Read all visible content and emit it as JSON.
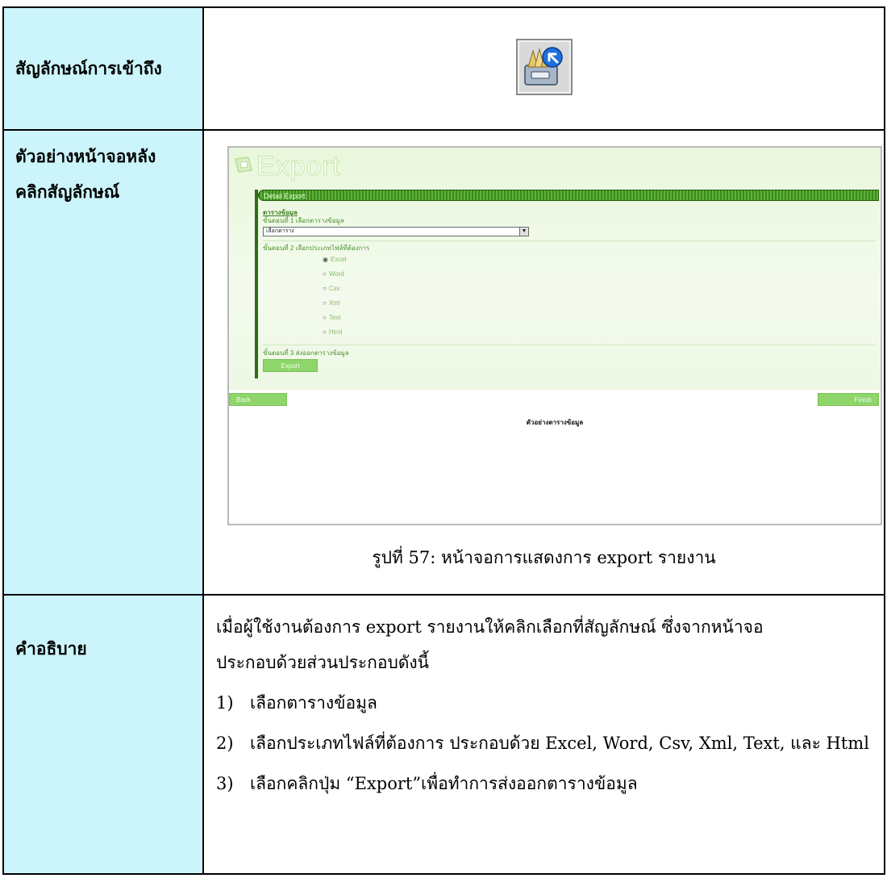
{
  "rows": {
    "icon_label": "สัญลักษณ์การเข้าถึง",
    "screenshot_label_line1": "ตัวอย่างหน้าจอหลัง",
    "screenshot_label_line2": "คลิกสัญลักษณ์",
    "description_label": "คำอธิบาย"
  },
  "icon": {
    "name": "export-drawer-icon",
    "accent": "#1d6fe0"
  },
  "screenshot": {
    "title": "Export",
    "panel_header": "Detail Export",
    "data_table_link": "ตารางข้อมูล",
    "step1_label": "ขั้นตอนที่ 1",
    "step1_text": "เลือกตารางข้อมูล",
    "table_select_value": "เลือกตาราง",
    "step2_label": "ขั้นตอนที่ 2",
    "step2_text": "เลือกประเภทไฟล์ที่ต้องการ",
    "file_types": [
      {
        "label": "Excel",
        "selected": true
      },
      {
        "label": "Word",
        "selected": false
      },
      {
        "label": "Csv",
        "selected": false
      },
      {
        "label": "Xml",
        "selected": false
      },
      {
        "label": "Text",
        "selected": false
      },
      {
        "label": "Html",
        "selected": false
      }
    ],
    "step3_label": "ขั้นตอนที่ 3",
    "step3_text": "ส่งออกตารางข้อมูล",
    "export_button": "Export",
    "back_button": "Back",
    "finish_button": "Finish",
    "preview_label": "ตัวอย่างตารางข้อมูล",
    "colors": {
      "accent": "#3b8a1e",
      "button": "#8ed56a",
      "background": "#eef8e4"
    }
  },
  "caption": "รูปที่ 57: หน้าจอการแสดงการ export รายงาน",
  "description": {
    "intro_line1": "เมื่อผู้ใช้งานต้องการ export รายงานให้คลิกเลือกที่สัญลักษณ์ ซึ่งจากหน้าจอ",
    "intro_line2": "ประกอบด้วยส่วนประกอบดังนี้",
    "items": [
      {
        "num": "1)",
        "text": "เลือกตารางข้อมูล"
      },
      {
        "num": "2)",
        "text": "เลือกประเภทไฟล์ที่ต้องการ ประกอบด้วย Excel, Word, Csv, Xml, Text, และ Html"
      },
      {
        "num": "3)",
        "text": "เลือกคลิกปุ่ม “Export”เพื่อทำการส่งออกตารางข้อมูล"
      }
    ]
  }
}
